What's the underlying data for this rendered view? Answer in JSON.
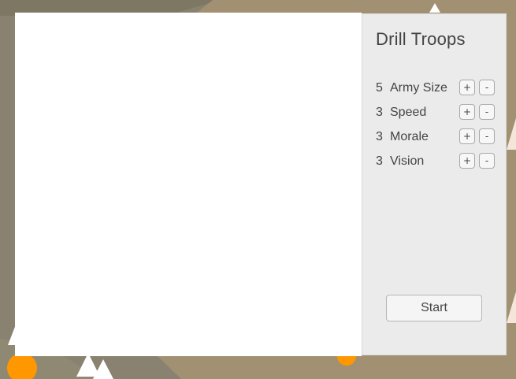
{
  "panel": {
    "title": "Drill Troops",
    "stats": [
      {
        "value": "5",
        "label": "Army Size",
        "plus": "+",
        "minus": "-"
      },
      {
        "value": "3",
        "label": "Speed",
        "plus": "+",
        "minus": "-"
      },
      {
        "value": "3",
        "label": "Morale",
        "plus": "+",
        "minus": "-"
      },
      {
        "value": "3",
        "label": "Vision",
        "plus": "+",
        "minus": "-"
      }
    ],
    "start_label": "Start"
  },
  "colors": {
    "terrain": "#8a8270",
    "terrain_light": "#a19072",
    "unit_orange": "#ff9800",
    "panel_bg": "#ebebeb"
  }
}
